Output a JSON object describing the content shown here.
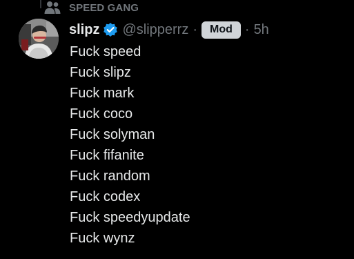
{
  "context": {
    "icon": "community-icon",
    "label": "SPEED GANG"
  },
  "post": {
    "avatar_icon": "user-avatar",
    "display_name": "slipz",
    "verified_icon": "verified-badge-icon",
    "handle": "@slipperrz",
    "separator": "·",
    "role_badge": "Mod",
    "time_separator": "·",
    "time": "5h",
    "lines": [
      "Fuck speed",
      "Fuck slipz",
      "Fuck mark",
      "Fuck coco",
      "Fuck solyman",
      "Fuck fifanite",
      "Fuck random",
      "Fuck codex",
      "Fuck speedyupdate",
      "Fuck wynz"
    ]
  },
  "colors": {
    "background": "#000000",
    "primary_text": "#e7e9ea",
    "secondary_text": "#71767b",
    "verified": "#1d9bf0",
    "badge_bg": "#d0d4d8"
  }
}
